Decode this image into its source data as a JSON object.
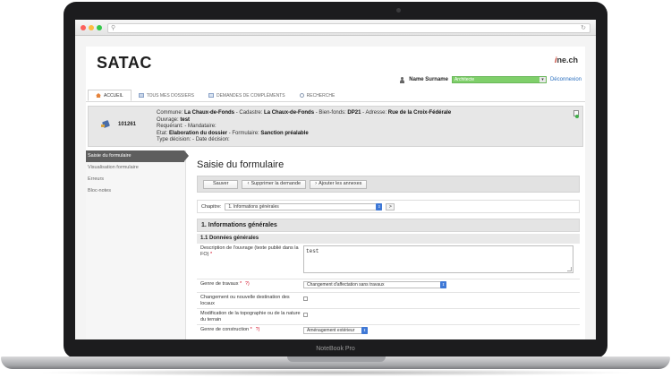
{
  "device": {
    "label": "NoteBook Pro"
  },
  "header": {
    "logo": "SATAC",
    "brand_accent": "i",
    "brand_rest": "ne.ch",
    "user_label": "Name Surname",
    "role": "Architecte",
    "logout": "Déconnexion"
  },
  "tabs": [
    {
      "label": "ACCUEIL",
      "icon": "home-icon"
    },
    {
      "label": "TOUS MES DOSSIERS",
      "icon": "folder-icon"
    },
    {
      "label": "DEMANDES DE COMPLÉMENTS",
      "icon": "documents-icon"
    },
    {
      "label": "RECHERCHE",
      "icon": "search-icon"
    }
  ],
  "dossier": {
    "id": "101261",
    "line1_parts": [
      "Commune: ",
      "La Chaux-de-Fonds",
      " - Cadastre: ",
      "La Chaux-de-Fonds",
      " - Bien-fonds: ",
      "DP21",
      " - Adresse: ",
      "Rue de la Croix-Fédérale"
    ],
    "line2_parts": [
      "Ouvrage: ",
      "test"
    ],
    "line3": "Requérant: - Mandataire:",
    "line4_parts": [
      "Etat: ",
      "Elaboration du dossier",
      " - Formulaire: ",
      "Sanction préalable"
    ],
    "line5": "Type décision: - Date décision:"
  },
  "sidebar": {
    "items": [
      {
        "label": "Saisie du formulaire"
      },
      {
        "label": "Visualisation formulaire"
      },
      {
        "label": "Erreurs"
      },
      {
        "label": "Bloc-notes"
      }
    ]
  },
  "main": {
    "title": "Saisie du formulaire",
    "toolbar": {
      "save": "Sauver",
      "delete": "Supprimer la demande",
      "annexes": "Ajouter les annexes"
    },
    "chapter_label": "Chapitre:",
    "chapter_value": "1. Informations générales",
    "go": ">",
    "section": "1. Informations générales",
    "subsection": "1.1 Données générales",
    "fields": {
      "description_label": "Description de l'ouvrage (texte publié dans la FO)",
      "description_value": "test",
      "genre_travaux_label": "Genre de travaux",
      "genre_travaux_value": "Changement d'affectation sans travaux",
      "changement_label": "Changement ou nouvelle destination des locaux",
      "modification_label": "Modification de la topographie ou de la nature du terrain",
      "genre_construction_label": "Genre de construction",
      "genre_construction_value": "Aménagement extérieur"
    },
    "required_mark": "*",
    "help_mark": "?)"
  }
}
